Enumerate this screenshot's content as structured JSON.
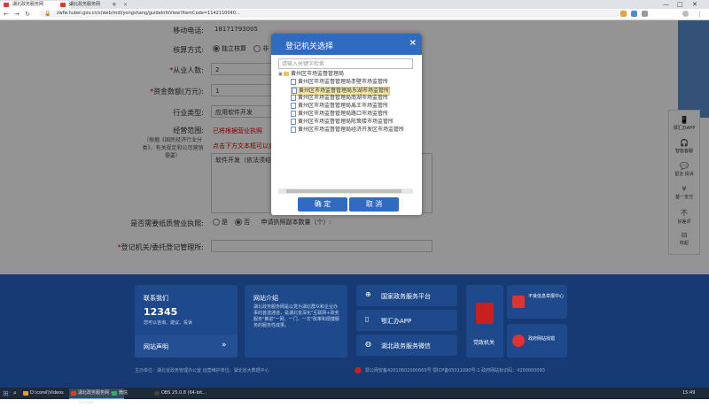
{
  "browser": {
    "tabs": [
      {
        "label": "湖北政务服务网"
      },
      {
        "label": "湖北政务服务网"
      }
    ],
    "url": "zwfw.hubei.gov.cn/s/web/mdl/yongshang/guideInfoView?itemCode=1142110040...",
    "window_controls": [
      "—",
      "□",
      "✕"
    ]
  },
  "form": {
    "fields": [
      {
        "label": "移动电话:",
        "required": false,
        "value": "18171793005"
      },
      {
        "label": "核算方式:",
        "required": false,
        "options": [
          "独立核算",
          "非"
        ]
      },
      {
        "label": "从业人数:",
        "required": true,
        "value": "2"
      },
      {
        "label": "资金数额(万元):",
        "required": true,
        "value": "1"
      },
      {
        "label": "行业类型:",
        "required": false,
        "value": "应用软件开发"
      },
      {
        "label": "经营范围:",
        "required": false,
        "value": "软件开发（依法须经"
      }
    ],
    "scope_red_1": "已将根据营业执照",
    "scope_red_2": "点击下方文本框可以查看",
    "scope_note": "（根据《国民经济行业分类》，有关规定和公司营销需要）",
    "license_label": "是否需要纸质营业执照:",
    "license_options": [
      "是",
      "否"
    ],
    "license_count_label": "申请执照副本数量（个）:",
    "registrar_label": "登记机关/委托登记管理所:"
  },
  "modal": {
    "title": "登记机关选择",
    "close": "×",
    "search_placeholder": "请输入关键字检索",
    "tree": {
      "root": "黄州区市场监督管理局",
      "children": [
        "黄州区市场监督管理局赤壁市场监管所",
        "黄州区市场监督管理局东湖市场监管所",
        "黄州区市场监督管理局南湖市场监管所",
        "黄州区市场监督管理局禹王市场监管所",
        "黄州区市场监督管理局路口市场监管所",
        "黄州区市场监督管理局陈策楼市场监管所",
        "黄州区市场监督管理局经济开发区市场监管所"
      ],
      "selected_index": 1
    },
    "confirm": "确 定",
    "cancel": "取 消"
  },
  "right_bar": {
    "items": [
      {
        "icon": "phone-icon",
        "glyph": "📱",
        "label": "鄂汇办APP"
      },
      {
        "icon": "headset-icon",
        "glyph": "🎧",
        "label": "智能客服"
      },
      {
        "icon": "comment-icon",
        "glyph": "💬",
        "label": "留言 投诉"
      },
      {
        "icon": "yen-icon",
        "glyph": "¥",
        "label": "楚一支付"
      },
      {
        "icon": "chinese-char-icon",
        "glyph": "不",
        "label": "好差评"
      },
      {
        "icon": "collapse-icon",
        "glyph": "⊟",
        "label": "收起"
      }
    ]
  },
  "footer": {
    "contact_title": "联系我们",
    "hotline": "12345",
    "contact_desc": "您可以咨询、建议、投诉",
    "statement": "网站声明",
    "intro_title": "网站介绍",
    "intro_text": "湖北政务服务网是以党为湖北群众和企业办事的首选通道，是湖北省深化\"互联网+政务服务\"推进\"一网、一门、一次\"改革和便捷服务的服务性成果。",
    "links": [
      "国家政务服务平台",
      "鄂汇办APP",
      "湖北政务服务微信"
    ],
    "party_label": "党政机关",
    "badges": [
      "不良信息举报中心",
      "政府网站找错"
    ],
    "bottom_left": "主办单位：湖北省政务管理办公室  运营维护单位：湖北省大数据中心",
    "bottom_right": "鄂公网安备42010602000665号  鄂ICP备05011090号-1  政府网站标识码：4200000093"
  },
  "taskbar": {
    "items": [
      {
        "label": "D:\\corel\\Videos",
        "color": "#d9a43a"
      },
      {
        "label": "湖北政务服务网 - Google...",
        "color": "#e23b2e",
        "active": true
      },
      {
        "label": "微信",
        "color": "#2aae67"
      },
      {
        "label": "OBS 25.0.8 (64-bit...",
        "color": "#444"
      }
    ],
    "clock": "15:49"
  }
}
